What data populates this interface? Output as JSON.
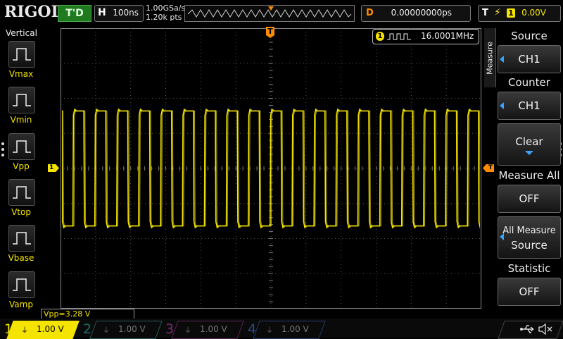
{
  "brand": "RIGOL",
  "top": {
    "run_status": "T'D",
    "horiz_key": "H",
    "timebase": "100ns",
    "sample_rate": "1.00GSa/s",
    "mem_depth": "1.20k pts",
    "delay_key": "D",
    "delay_value": "0.00000000ps",
    "trig_key": "T",
    "trig_source": "1",
    "trig_level": "0.00V"
  },
  "left_panel": {
    "title": "Vertical",
    "items": [
      "Vmax",
      "Vmin",
      "Vpp",
      "Vtop",
      "Vbase",
      "Vamp"
    ]
  },
  "screen": {
    "freq_channel": "1",
    "frequency": "16.0001MHz",
    "ch1_marker": "1",
    "trig_marker": "T",
    "measurement_readout": "Vpp=3.28 V"
  },
  "right_panel": {
    "menu_title": "Measure",
    "source_title": "Source",
    "source_value": "CH1",
    "counter_title": "Counter",
    "counter_value": "CH1",
    "clear_label": "Clear",
    "measure_all_title": "Measure All",
    "measure_all_value": "OFF",
    "all_measure_source_line1": "All Measure",
    "all_measure_source_line2": "Source",
    "statistic_title": "Statistic",
    "statistic_value": "OFF"
  },
  "channels": [
    {
      "num": "1",
      "value": "1.00 V",
      "color": "#f5e400",
      "active": true
    },
    {
      "num": "2",
      "value": "1.00 V",
      "color": "#1fd6c8",
      "active": false
    },
    {
      "num": "3",
      "value": "1.00 V",
      "color": "#e23bd6",
      "active": false
    },
    {
      "num": "4",
      "value": "1.00 V",
      "color": "#2f6bff",
      "active": false
    }
  ],
  "colors": {
    "ch1": "#f5e400",
    "trigger": "#ff8c00",
    "grid": "#555555",
    "accent_blue": "#3aa0ff"
  },
  "waveform": {
    "frequency_hz": 16000100,
    "timebase_s_per_div": 1e-07,
    "volts_per_div": 1.0,
    "high_level_v": 1.64,
    "low_level_v": -1.64
  },
  "icons": [
    "usb-icon",
    "speaker-mute-icon",
    "ground-icon"
  ]
}
